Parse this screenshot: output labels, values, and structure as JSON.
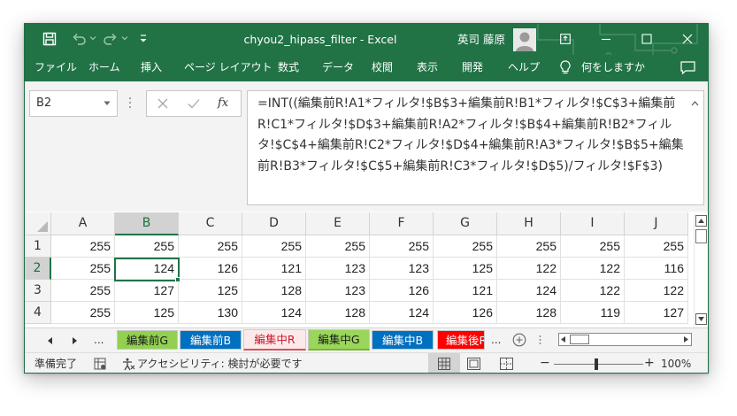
{
  "titlebar": {
    "document_title": "chyou2_hipass_filter  -  Excel",
    "user_name": "英司 藤原",
    "icons": [
      "save-icon",
      "undo-icon",
      "redo-icon",
      "customize-qat-icon",
      "ribbon-display-icon",
      "minimize-icon",
      "maximize-icon",
      "close-icon"
    ]
  },
  "ribbon": {
    "tabs": [
      "ファイル",
      "ホーム",
      "挿入",
      "ページ レイアウト",
      "数式",
      "データ",
      "校閲",
      "表示",
      "開発",
      "ヘルプ"
    ],
    "tell_me": "何をしますか"
  },
  "formula_bar": {
    "name_box": "B2",
    "fx_label": "fx",
    "formula": "=INT((編集前R!A1*フィルタ!$B$3+編集前R!B1*フィルタ!$C$3+編集前R!C1*フィルタ!$D$3+編集前R!A2*フィルタ!$B$4+編集前R!B2*フィルタ!$C$4+編集前R!C2*フィルタ!$D$4+編集前R!A3*フィルタ!$B$5+編集前R!B3*フィルタ!$C$5+編集前R!C3*フィルタ!$D$5)/フィルタ!$F$3)"
  },
  "grid": {
    "columns": [
      "A",
      "B",
      "C",
      "D",
      "E",
      "F",
      "G",
      "H",
      "I",
      "J"
    ],
    "selected_column": "B",
    "selected_row": "2",
    "rows": [
      {
        "header": "1",
        "cells": [
          "255",
          "255",
          "255",
          "255",
          "255",
          "255",
          "255",
          "255",
          "255",
          "255"
        ]
      },
      {
        "header": "2",
        "cells": [
          "255",
          "124",
          "126",
          "121",
          "123",
          "123",
          "125",
          "122",
          "122",
          "116"
        ]
      },
      {
        "header": "3",
        "cells": [
          "255",
          "127",
          "125",
          "128",
          "123",
          "126",
          "121",
          "124",
          "122",
          "122"
        ]
      },
      {
        "header": "4",
        "cells": [
          "255",
          "125",
          "130",
          "124",
          "128",
          "124",
          "126",
          "128",
          "119",
          "127"
        ]
      }
    ]
  },
  "sheet_tabs": {
    "more_label": "...",
    "tabs": [
      {
        "label": "編集前G",
        "color": "#92d050"
      },
      {
        "label": "編集前B",
        "color": "#0070c0"
      },
      {
        "label": "編集中R",
        "color": "#fde9ea"
      },
      {
        "label": "編集中G",
        "color": "#92d050"
      },
      {
        "label": "編集中B",
        "color": "#0070c0"
      },
      {
        "label": "編集後R",
        "color": "#ff0000"
      }
    ],
    "active_tab": "編集中R"
  },
  "status_bar": {
    "ready": "準備完了",
    "accessibility": "アクセシビリティ: 検討が必要です",
    "zoom_minus": "−",
    "zoom_plus": "+",
    "zoom_level": "100%"
  },
  "colors": {
    "excel_green": "#217346",
    "selection_green": "#217346"
  }
}
